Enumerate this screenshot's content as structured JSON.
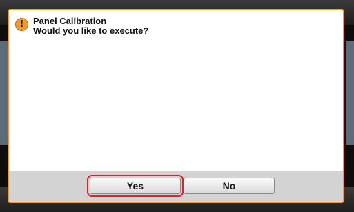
{
  "dialog": {
    "title": "Panel Calibration",
    "message": "Would you like to execute?",
    "icon": "warning-icon",
    "icon_glyph": "!",
    "accent_color": "#f39a2a",
    "highlight_color": "#e0202a"
  },
  "buttons": {
    "yes_label": "Yes",
    "no_label": "No"
  }
}
